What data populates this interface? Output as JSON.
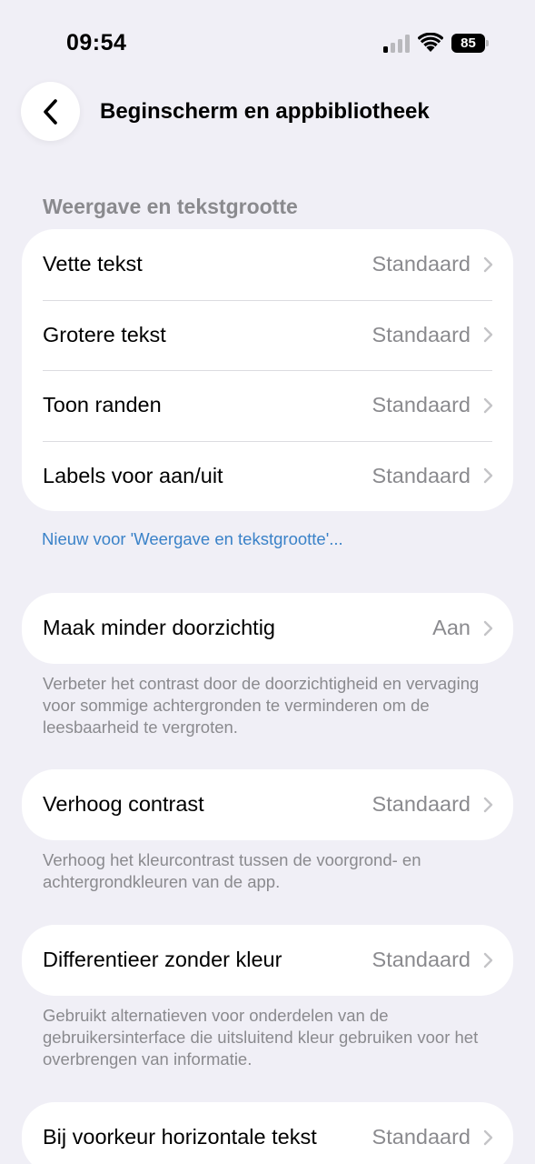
{
  "status_bar": {
    "time": "09:54",
    "battery": "85",
    "signal_icon": "cellular-signal-icon",
    "wifi_icon": "wifi-icon"
  },
  "nav": {
    "title": "Beginscherm en appbibliotheek",
    "back_icon": "chevron-left-icon"
  },
  "sections": {
    "display": {
      "header": "Weergave en tekstgrootte",
      "rows": [
        {
          "label": "Vette tekst",
          "value": "Standaard"
        },
        {
          "label": "Grotere tekst",
          "value": "Standaard"
        },
        {
          "label": "Toon randen",
          "value": "Standaard"
        },
        {
          "label": "Labels voor aan/uit",
          "value": "Standaard"
        }
      ],
      "link": "Nieuw voor 'Weergave en tekstgrootte'..."
    },
    "transparency": {
      "label": "Maak minder doorzichtig",
      "value": "Aan",
      "footnote": "Verbeter het contrast door de doorzichtigheid en vervaging voor sommige achtergronden te verminderen om de leesbaarheid te vergroten."
    },
    "contrast": {
      "label": "Verhoog contrast",
      "value": "Standaard",
      "footnote": "Verhoog het kleurcontrast tussen de voorgrond- en achtergrondkleuren van de app."
    },
    "differentiate": {
      "label": "Differentieer zonder kleur",
      "value": "Standaard",
      "footnote": "Gebruikt alternatieven voor onderdelen van de gebruikersinterface die uitsluitend kleur gebruiken voor het overbrengen van informatie."
    },
    "horizontal": {
      "label": "Bij voorkeur horizontale tekst",
      "value": "Standaard"
    }
  },
  "colors": {
    "background": "#f0eff6",
    "card": "#ffffff",
    "secondary_text": "#8a8a8e",
    "link": "#3a82c8"
  }
}
